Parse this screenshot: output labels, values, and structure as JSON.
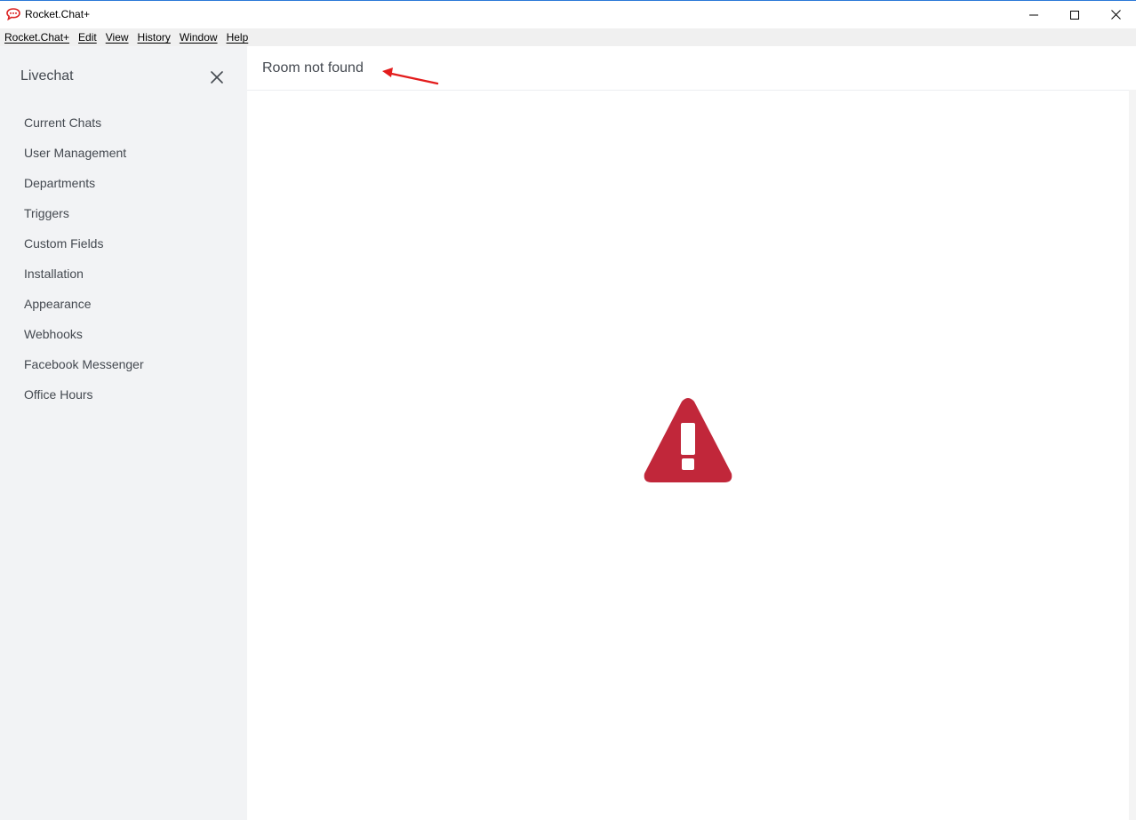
{
  "window": {
    "title": "Rocket.Chat+",
    "app_icon": "rocketchat-speech-bubble-icon",
    "accent_color": "#db2323"
  },
  "menu": {
    "items": [
      {
        "label": "Rocket.Chat+"
      },
      {
        "label": "Edit"
      },
      {
        "label": "View"
      },
      {
        "label": "History"
      },
      {
        "label": "Window"
      },
      {
        "label": "Help"
      }
    ]
  },
  "sidebar": {
    "title": "Livechat",
    "close_icon": "close-icon",
    "items": [
      {
        "label": "Current Chats"
      },
      {
        "label": "User Management"
      },
      {
        "label": "Departments"
      },
      {
        "label": "Triggers"
      },
      {
        "label": "Custom Fields"
      },
      {
        "label": "Installation"
      },
      {
        "label": "Appearance"
      },
      {
        "label": "Webhooks"
      },
      {
        "label": "Facebook Messenger"
      },
      {
        "label": "Office Hours"
      }
    ]
  },
  "main": {
    "title": "Room not found",
    "warning_icon": "warning-triangle-icon",
    "warning_color": "#c1273a",
    "annotation_color": "#e31c1c"
  }
}
